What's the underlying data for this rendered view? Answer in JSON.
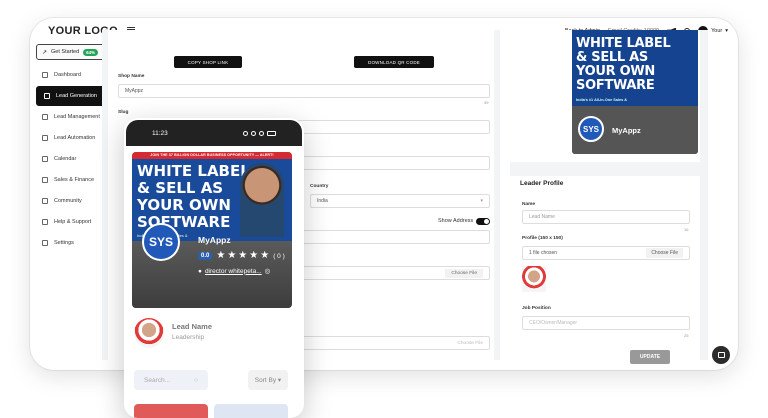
{
  "header": {
    "logo": "YOUR LOGO",
    "back": "← Back to Admin",
    "credits": "Email Credits: 10000",
    "user": "Your"
  },
  "sidebar": {
    "get_started": "Get Started",
    "progress": "64%",
    "items": [
      {
        "label": "Dashboard"
      },
      {
        "label": "Lead Generation"
      },
      {
        "label": "Lead Management"
      },
      {
        "label": "Lead Automation"
      },
      {
        "label": "Calendar"
      },
      {
        "label": "Sales & Finance"
      },
      {
        "label": "Community"
      },
      {
        "label": "Help & Support"
      },
      {
        "label": "Settings"
      }
    ]
  },
  "main": {
    "copy_link": "COPY SHOP LINK",
    "download_qr": "DOWNLOAD QR CODE",
    "shop_name_label": "Shop Name",
    "shop_name_value": "MyAppz",
    "shop_name_count": "39",
    "slug_label": "Slug",
    "country_label": "Country",
    "country_value": "India",
    "show_address": "Show Address",
    "choose_file": "Choose File",
    "choose_file2": "Choose File"
  },
  "right": {
    "promo": {
      "line1": "WHITE LABEL",
      "line2": "& SELL AS",
      "line3": "YOUR OWN",
      "line4": "SOFTWARE",
      "tagline": "India's #1 All-in-One Sales &",
      "brand": "MyAppz",
      "logo": "SYS"
    },
    "leader": {
      "title": "Leader Profile",
      "name_label": "Name",
      "name_placeholder": "Lead Name",
      "name_count": "16",
      "profile_label": "Profile (150 x 150)",
      "file_chosen": "1 file chosen",
      "choose_file": "Choose File",
      "job_label": "Job Position",
      "job_placeholder": "CEO/Owner/Manager",
      "job_count": "25"
    }
  },
  "phone": {
    "time": "11:23",
    "banner": "JOIN THE 37 BILLION DOLLAR BUSINESS OPPORTUNITY — ALERT!",
    "promo": {
      "line1": "WHITE LABEL",
      "line2": "& SELL AS",
      "line3": "YOUR OWN",
      "line4": "SOFTWARE",
      "tagline": "India's #1 All-in-One Sales &"
    },
    "brand": "MyAppz",
    "logo": "SYS",
    "rating": "0.0",
    "rating_count": "( 0 )",
    "link": "director whitepeta...",
    "leader_name": "Lead Name",
    "leader_role": "Leadership",
    "search_placeholder": "Search...",
    "sort": "Sort By"
  },
  "footer": {
    "update": "UPDATE"
  }
}
